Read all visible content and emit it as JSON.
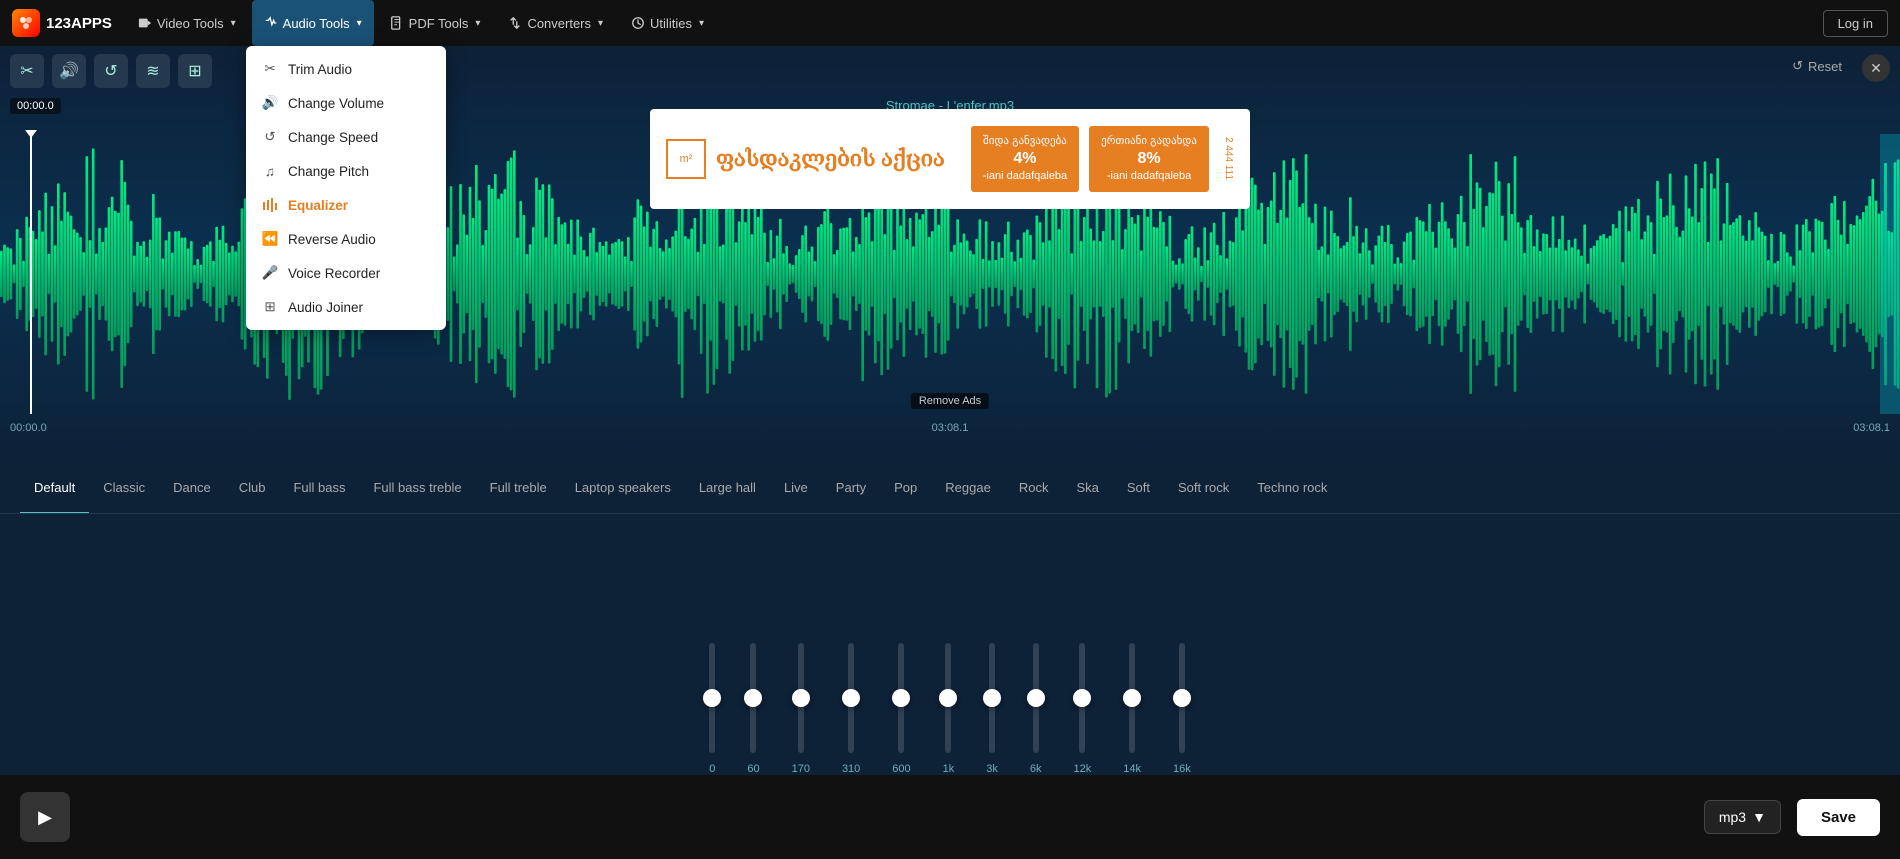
{
  "app": {
    "logo_text": "123APPS",
    "login_label": "Log in"
  },
  "nav": {
    "video_tools": "Video Tools",
    "audio_tools": "Audio Tools",
    "pdf_tools": "PDF Tools",
    "converters": "Converters",
    "utilities": "Utilities"
  },
  "dropdown": {
    "title": "Audio Tools",
    "items": [
      {
        "id": "trim",
        "label": "Trim Audio",
        "icon": "scissors"
      },
      {
        "id": "volume",
        "label": "Change Volume",
        "icon": "volume"
      },
      {
        "id": "speed",
        "label": "Change Speed",
        "icon": "speed"
      },
      {
        "id": "pitch",
        "label": "Change Pitch",
        "icon": "pitch"
      },
      {
        "id": "equalizer",
        "label": "Equalizer",
        "icon": "equalizer",
        "active": true
      },
      {
        "id": "reverse",
        "label": "Reverse Audio",
        "icon": "reverse"
      },
      {
        "id": "voice",
        "label": "Voice Recorder",
        "icon": "mic"
      },
      {
        "id": "joiner",
        "label": "Audio Joiner",
        "icon": "joiner"
      }
    ]
  },
  "waveform": {
    "filename": "Stromae - L'enfer.mp3",
    "time_start": "00:00.0",
    "time_end": "03:08.1",
    "time_mid": "03:08.1",
    "time_badge": "00:00.0",
    "reset_label": "Reset"
  },
  "eq": {
    "tabs": [
      {
        "id": "default",
        "label": "Default",
        "active": true
      },
      {
        "id": "classic",
        "label": "Classic"
      },
      {
        "id": "dance",
        "label": "Dance"
      },
      {
        "id": "club",
        "label": "Club"
      },
      {
        "id": "full_bass",
        "label": "Full bass"
      },
      {
        "id": "full_bass_treble",
        "label": "Full bass treble"
      },
      {
        "id": "full_treble",
        "label": "Full treble"
      },
      {
        "id": "laptop",
        "label": "Laptop speakers"
      },
      {
        "id": "large_hall",
        "label": "Large hall"
      },
      {
        "id": "live",
        "label": "Live"
      },
      {
        "id": "party",
        "label": "Party"
      },
      {
        "id": "pop",
        "label": "Pop"
      },
      {
        "id": "reggae",
        "label": "Reggae"
      },
      {
        "id": "rock",
        "label": "Rock"
      },
      {
        "id": "ska",
        "label": "Ska"
      },
      {
        "id": "soft",
        "label": "Soft"
      },
      {
        "id": "soft_rock",
        "label": "Soft rock"
      },
      {
        "id": "techno_rock",
        "label": "Techno rock"
      }
    ],
    "sliders": [
      {
        "label": "0",
        "position": 50
      },
      {
        "label": "60",
        "position": 50
      },
      {
        "label": "170",
        "position": 50
      },
      {
        "label": "310",
        "position": 50
      },
      {
        "label": "600",
        "position": 50
      },
      {
        "label": "1k",
        "position": 50
      },
      {
        "label": "3k",
        "position": 50
      },
      {
        "label": "6k",
        "position": 50
      },
      {
        "label": "12k",
        "position": 50
      },
      {
        "label": "14k",
        "position": 50
      },
      {
        "label": "16k",
        "position": 50
      }
    ]
  },
  "bottom": {
    "format_label": "mp3",
    "format_arrow": "▼",
    "save_label": "Save"
  }
}
